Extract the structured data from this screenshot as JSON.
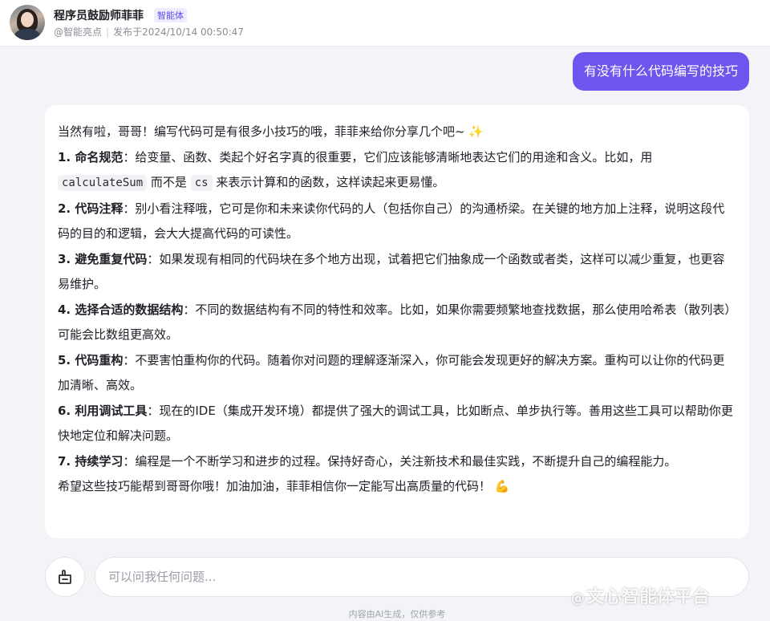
{
  "header": {
    "bot_name": "程序员鼓励师菲菲",
    "badge": "智能体",
    "author": "@智能亮点",
    "published": "发布于2024/10/14 00:50:47"
  },
  "user_message": "有没有什么代码编写的技巧",
  "answer": {
    "intro": "当然有啦，哥哥！编写代码可是有很多小技巧的哦，菲菲来给你分享几个吧~ ",
    "intro_emoji": "✨",
    "tips": [
      {
        "title": "1. 命名规范",
        "text_before": "：给变量、函数、类起个好名字真的很重要，它们应该能够清晰地表达它们的用途和含义。比如，用 ",
        "code1": "calculateSum",
        "text_mid": " 而不是 ",
        "code2": "cs",
        "text_after": " 来表示计算和的函数，这样读起来更易懂。"
      },
      {
        "title": "2. 代码注释",
        "text": "：别小看注释哦，它可是你和未来读你代码的人（包括你自己）的沟通桥梁。在关键的地方加上注释，说明这段代码的目的和逻辑，会大大提高代码的可读性。"
      },
      {
        "title": "3. 避免重复代码",
        "text": "：如果发现有相同的代码块在多个地方出现，试着把它们抽象成一个函数或者类，这样可以减少重复，也更容易维护。"
      },
      {
        "title": "4. 选择合适的数据结构",
        "text": "：不同的数据结构有不同的特性和效率。比如，如果你需要频繁地查找数据，那么使用哈希表（散列表）可能会比数组更高效。"
      },
      {
        "title": "5. 代码重构",
        "text": "：不要害怕重构你的代码。随着你对问题的理解逐渐深入，你可能会发现更好的解决方案。重构可以让你的代码更加清晰、高效。"
      },
      {
        "title": "6. 利用调试工具",
        "text": "：现在的IDE（集成开发环境）都提供了强大的调试工具，比如断点、单步执行等。善用这些工具可以帮助你更快地定位和解决问题。"
      },
      {
        "title": "7. 持续学习",
        "text": "：编程是一个不断学习和进步的过程。保持好奇心，关注新技术和最佳实践，不断提升自己的编程能力。"
      }
    ],
    "closing": "希望这些技巧能帮到哥哥你哦！加油加油，菲菲相信你一定能写出高质量的代码！ ",
    "closing_emoji": "💪"
  },
  "input": {
    "placeholder": "可以问我任何问题..."
  },
  "footer_note": "内容由AI生成，仅供参考",
  "watermark": {
    "at": "@",
    "text": "文心智能体平台"
  },
  "icons": {
    "new_chat": "new-chat-icon"
  },
  "colors": {
    "accent": "#6f55ee",
    "badge_text": "#5a4ee6"
  }
}
